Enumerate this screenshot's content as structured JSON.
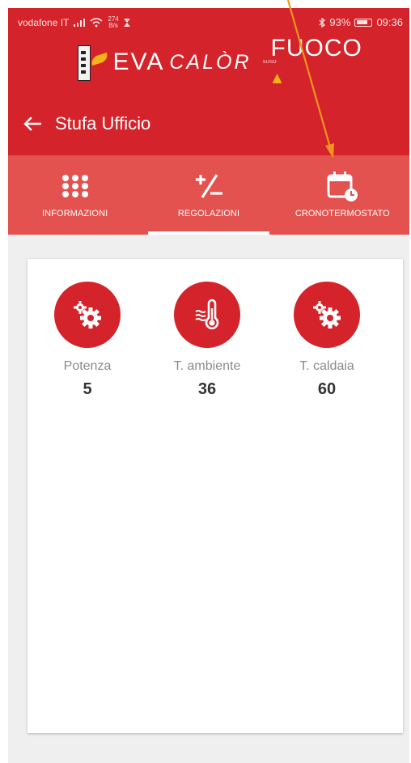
{
  "status_bar": {
    "carrier": "vodafone IT",
    "speed_value": "274",
    "speed_unit": "B/s",
    "battery_percent": "93%",
    "time": "09:36"
  },
  "logo": {
    "eva": "EVA",
    "calor": "CALÒR",
    "fuoco": "FUOCO",
    "small_text": "SUSO"
  },
  "header": {
    "title": "Stufa Ufficio"
  },
  "tabs": [
    {
      "label": "INFORMAZIONI",
      "icon": "grid-dots-icon",
      "active": false
    },
    {
      "label": "REGOLAZIONI",
      "icon": "plus-minus-icon",
      "active": true
    },
    {
      "label": "CRONOTERMOSTATO",
      "icon": "calendar-clock-icon",
      "active": false
    }
  ],
  "parameters": [
    {
      "label": "Potenza",
      "value": "5",
      "icon": "gears-icon"
    },
    {
      "label": "T. ambiente",
      "value": "36",
      "icon": "thermometer-icon"
    },
    {
      "label": "T. caldaia",
      "value": "60",
      "icon": "gears-icon"
    }
  ],
  "colors": {
    "brand_red": "#d4232a",
    "tab_bar": "#e4524f",
    "annotation_arrow": "#f0961e"
  }
}
